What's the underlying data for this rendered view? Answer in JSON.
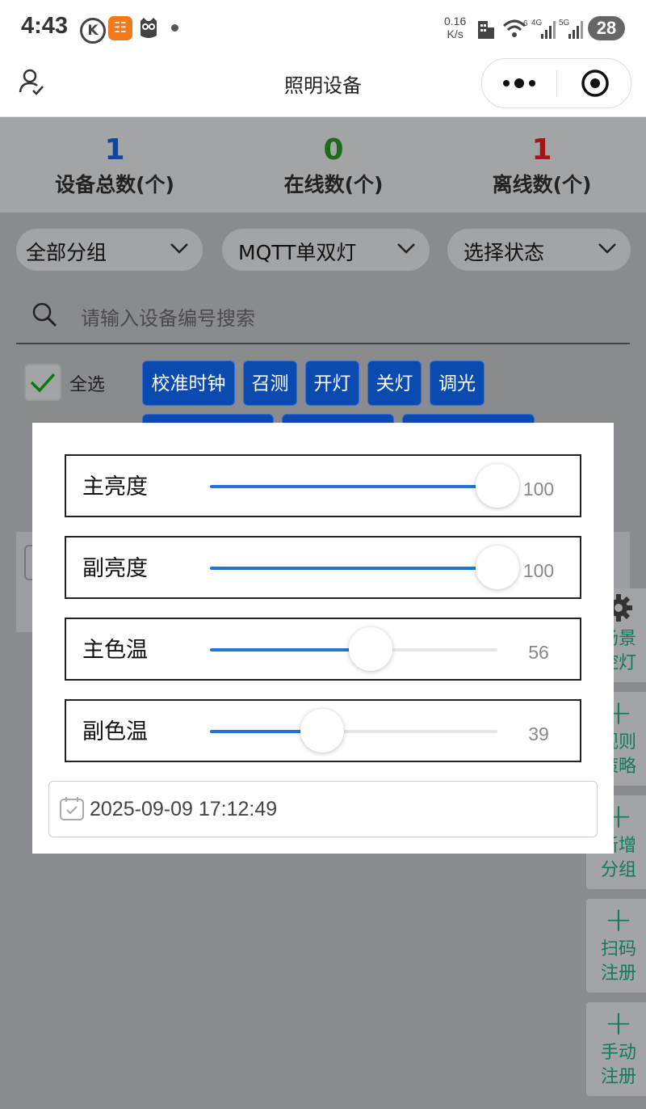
{
  "status_bar": {
    "time": "4:43",
    "k_badge": "K",
    "speed_value": "0.16",
    "speed_unit": "K/s",
    "battery": "28",
    "net_4g": "4G",
    "net_5g": "5G",
    "wifi_badge": "6"
  },
  "nav": {
    "title": "照明设备"
  },
  "stats": [
    {
      "value": "1",
      "label": "设备总数(个)",
      "color": "#0d47a1"
    },
    {
      "value": "0",
      "label": "在线数(个)",
      "color": "#1b6b1b"
    },
    {
      "value": "1",
      "label": "离线数(个)",
      "color": "#a31515"
    }
  ],
  "filters": {
    "group": "全部分组",
    "type": "MQTT单双灯",
    "status": "选择状态"
  },
  "search": {
    "placeholder": "请输入设备编号搜索"
  },
  "select_all": {
    "label": "全选",
    "checked": true
  },
  "actions": [
    "校准时钟",
    "召测",
    "开灯",
    "关灯",
    "调光"
  ],
  "float_buttons": [
    {
      "icon": "gear-icon",
      "line1": "场景",
      "line2": "控灯"
    },
    {
      "icon": "plus-icon",
      "line1": "规则",
      "line2": "策略"
    },
    {
      "icon": "plus-icon",
      "line1": "新增",
      "line2": "分组"
    },
    {
      "icon": "plus-icon",
      "line1": "扫码",
      "line2": "注册"
    },
    {
      "icon": "plus-icon",
      "line1": "手动",
      "line2": "注册"
    }
  ],
  "dimming": {
    "sliders": [
      {
        "label": "主亮度",
        "value": 100
      },
      {
        "label": "副亮度",
        "value": 100
      },
      {
        "label": "主色温",
        "value": 56
      },
      {
        "label": "副色温",
        "value": 39
      }
    ],
    "datetime": "2025-09-09 17:12:49"
  }
}
